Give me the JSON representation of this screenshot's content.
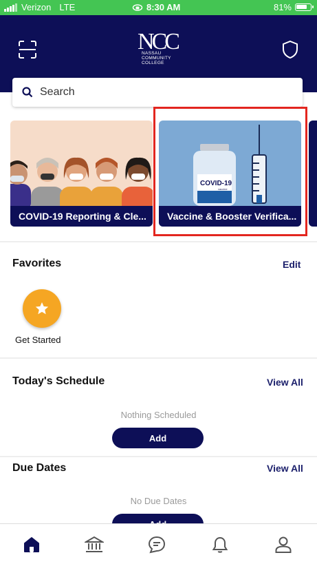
{
  "status_bar": {
    "carrier": "Verizon",
    "network": "LTE",
    "time": "8:30 AM",
    "battery": "81%",
    "battery_level": 0.81
  },
  "header": {
    "logo_text": "NCC",
    "logo_lines": [
      "NASSAU",
      "COMMUNITY",
      "COLLEGE"
    ],
    "icons": [
      "scan-icon",
      "shield-icon"
    ]
  },
  "search": {
    "placeholder": "Search"
  },
  "carousel": {
    "cards": [
      {
        "label": "COVID-19 Reporting & Cle..."
      },
      {
        "label": "Vaccine & Booster Verifica..."
      }
    ],
    "vial_label": "COVID-19",
    "vial_sub": "vaccine"
  },
  "favorites": {
    "title": "Favorites",
    "edit": "Edit",
    "items": [
      {
        "label": "Get Started",
        "icon": "star-icon"
      }
    ]
  },
  "schedule": {
    "title": "Today's Schedule",
    "view_all": "View All",
    "empty": "Nothing Scheduled",
    "add": "Add"
  },
  "due_dates": {
    "title": "Due Dates",
    "view_all": "View All",
    "empty": "No Due Dates",
    "add": "Add"
  },
  "tabbar": {
    "items": [
      "home-icon",
      "institution-icon",
      "chat-icon",
      "bell-icon",
      "profile-icon"
    ]
  },
  "colors": {
    "navy": "#0d0f57",
    "status_green": "#44c553",
    "accent_orange": "#f5a623",
    "highlight_red": "#e3261f"
  }
}
